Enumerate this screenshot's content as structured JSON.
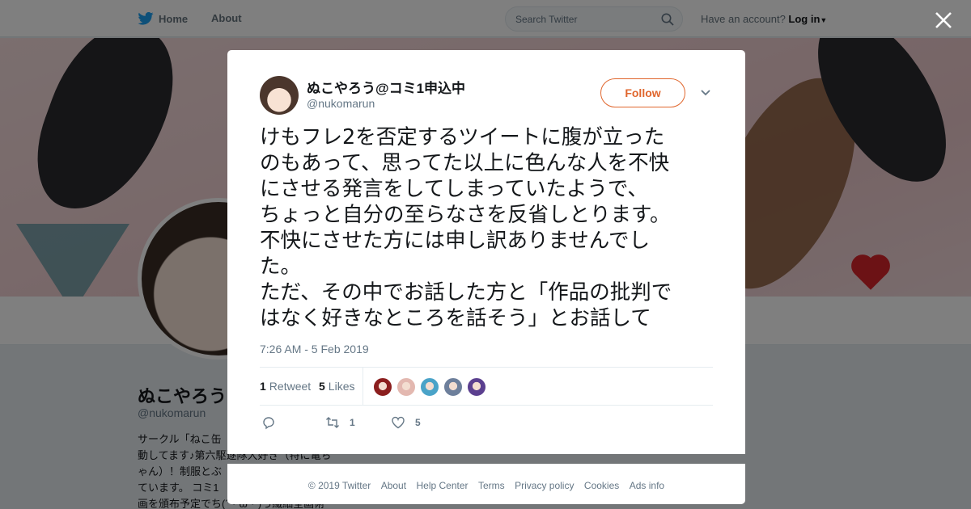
{
  "nav": {
    "home_label": "Home",
    "about_label": "About"
  },
  "search": {
    "placeholder": "Search Twitter"
  },
  "account": {
    "prompt": "Have an account?",
    "login_label": "Log in"
  },
  "profile": {
    "name": "ぬこやろう",
    "handle": "@nukomarun",
    "bio_lines": [
      "サークル「ねこ缶",
      "動してます♪第六駆逐隊大好き（特に電ち",
      "ゃん）！制服とぶ",
      "ています。 コミ1",
      "画を頒布予定でち(´・ω・)っ繊細全画術"
    ]
  },
  "tweet": {
    "author_name": "ぬこやろう@コミ1申込中",
    "author_handle": "@nukomarun",
    "follow_label": "Follow",
    "text_lines": [
      "けもフレ2を否定するツイートに腹が立った",
      "のもあって、思ってた以上に色んな人を不快",
      "にさせる発言をしてしまっていたようで、",
      "ちょっと自分の至らなさを反省しとります。",
      "不快にさせた方には申し訳ありませんでし",
      "た。",
      "ただ、その中でお話した方と「作品の批判で",
      "はなく好きなところを話そう」とお話して"
    ],
    "timestamp": "7:26 AM - 5 Feb 2019",
    "retweet_count": "1",
    "retweet_label": "Retweet",
    "likes_count": "5",
    "likes_label": "Likes",
    "reply_count": "",
    "action_retweet_count": "1",
    "action_like_count": "5"
  },
  "likers": [
    {
      "icon": "liker-avatar",
      "color": "#8b1e1e"
    },
    {
      "icon": "liker-avatar",
      "color": "#e3b8b0"
    },
    {
      "icon": "liker-avatar",
      "color": "#4aa3c8"
    },
    {
      "icon": "liker-avatar",
      "color": "#6d7f9b"
    },
    {
      "icon": "liker-avatar",
      "color": "#5b3f8f"
    }
  ],
  "footer": {
    "copyright": "© 2019 Twitter",
    "links": [
      "About",
      "Help Center",
      "Terms",
      "Privacy policy",
      "Cookies",
      "Ads info"
    ]
  },
  "colors": {
    "follow_accent": "#e0662d",
    "twitter_blue": "#1da1f2",
    "muted": "#657786"
  }
}
